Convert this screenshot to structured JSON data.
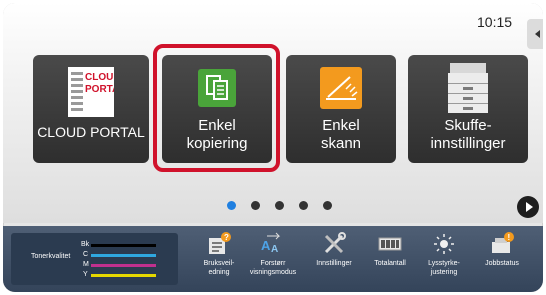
{
  "status": {
    "time": "10:15"
  },
  "tiles": [
    {
      "label1": "CLOUD PORTAL",
      "label2": "",
      "logo_line1": "CLOUD",
      "logo_line2": "PORTAL"
    },
    {
      "label1": "Enkel",
      "label2": "kopiering"
    },
    {
      "label1": "Enkel",
      "label2": "skann"
    },
    {
      "label1": "Skuffe-",
      "label2": "innstillinger"
    }
  ],
  "pagination": {
    "pages": 5,
    "active": 1
  },
  "toner": {
    "label": "Tonerkvalitet",
    "rows": [
      {
        "name": "Bk",
        "color": "#000000",
        "level": 0.95
      },
      {
        "name": "C",
        "color": "#2fa8e0",
        "level": 0.95
      },
      {
        "name": "M",
        "color": "#c0308e",
        "level": 0.95
      },
      {
        "name": "Y",
        "color": "#e5d800",
        "level": 0.95
      }
    ]
  },
  "bottom_items": [
    {
      "l1": "Bruksveil-",
      "l2": "edning",
      "icon": "guide-icon"
    },
    {
      "l1": "Forstørr",
      "l2": "visningsmodus",
      "icon": "zoom-display-icon"
    },
    {
      "l1": "Innstillinger",
      "l2": "",
      "icon": "settings-tools-icon"
    },
    {
      "l1": "Totalantall",
      "l2": "",
      "icon": "counter-icon"
    },
    {
      "l1": "Lysstyrke-",
      "l2": "justering",
      "icon": "brightness-icon"
    },
    {
      "l1": "Jobbstatus",
      "l2": "",
      "icon": "job-status-icon"
    }
  ],
  "colors": {
    "highlight": "#d0122b",
    "active_dot": "#1f7fe0",
    "copy_icon": "#4aa43a",
    "scan_icon": "#f39a1e"
  }
}
